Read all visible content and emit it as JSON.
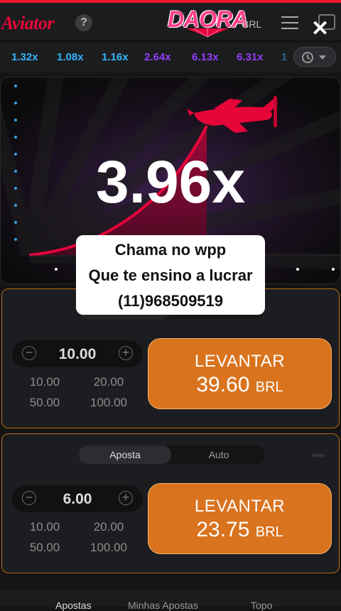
{
  "header": {
    "logo": "Aviator",
    "help_icon": "question-mark",
    "brand": "DAORA",
    "currency": "BRL",
    "menu_icon": "hamburger-menu",
    "chat_icon": "chat-bubble",
    "close_icon": "close-x"
  },
  "history": {
    "items": [
      {
        "value": "1.32x",
        "color": "#34b4ff"
      },
      {
        "value": "1.08x",
        "color": "#34b4ff"
      },
      {
        "value": "1.16x",
        "color": "#34b4ff"
      },
      {
        "value": "2.64x",
        "color": "#913ef8"
      },
      {
        "value": "6.13x",
        "color": "#913ef8"
      },
      {
        "value": "6.31x",
        "color": "#913ef8"
      },
      {
        "value": "1",
        "color": "#34b4ff"
      }
    ],
    "history_icon": "clock-history"
  },
  "game": {
    "multiplier": "3.96x",
    "plane_icon": "red-airplane",
    "curve_color": "#e50539"
  },
  "overlay": {
    "line1": "Chama no wpp",
    "line2": "Que te ensino a lucrar",
    "line3": "(11)968509519"
  },
  "bet_panel_1": {
    "stake": "10.00",
    "quick_amounts": [
      "10.00",
      "20.00",
      "50.00",
      "100.00"
    ],
    "action_label": "LEVANTAR",
    "action_amount": "39.60",
    "action_currency": "BRL"
  },
  "bet_panel_2": {
    "tabs": [
      "Aposta",
      "Auto"
    ],
    "active_tab": "Aposta",
    "stake": "6.00",
    "quick_amounts": [
      "10.00",
      "20.00",
      "50.00",
      "100.00"
    ],
    "action_label": "LEVANTAR",
    "action_amount": "23.75",
    "action_currency": "BRL"
  },
  "bottom_tabs": [
    "Apostas",
    "Minhas Apostas",
    "Topo"
  ],
  "colors": {
    "accent_red": "#e50539",
    "cashout_orange": "#d9731e",
    "panel_border": "#b86a12"
  }
}
